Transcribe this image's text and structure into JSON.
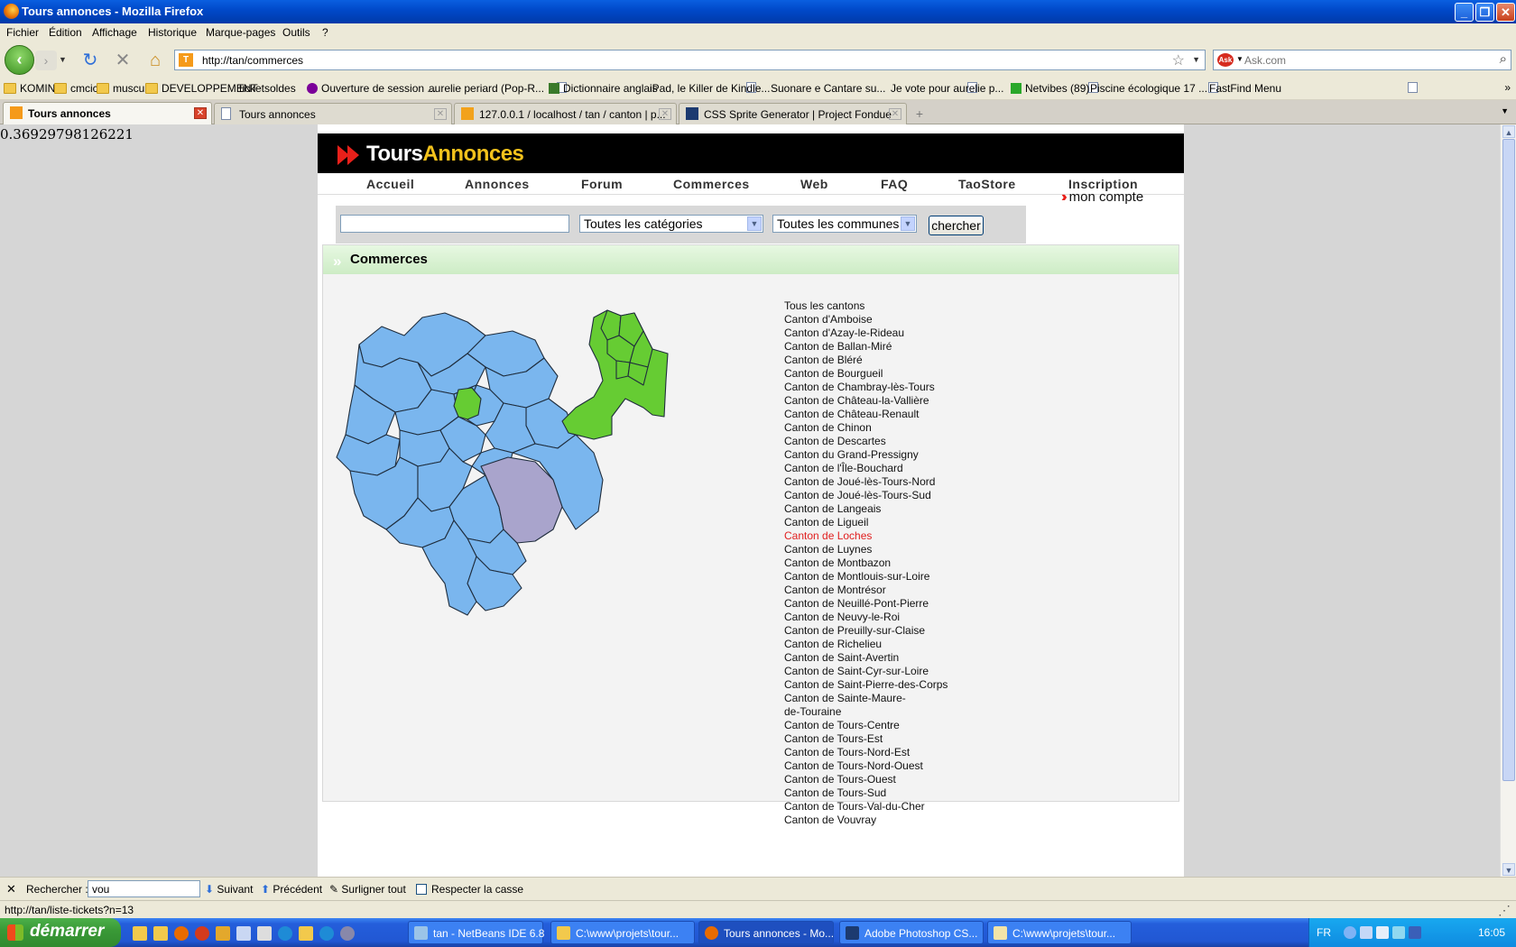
{
  "window": {
    "title": "Tours annonces - Mozilla Firefox",
    "minimize": "_",
    "maximize": "❐",
    "close": "✕"
  },
  "menu": [
    "Fichier",
    "Édition",
    "Affichage",
    "Historique",
    "Marque-pages",
    "Outils",
    "?"
  ],
  "navbar": {
    "url": "http://tan/commerces",
    "search_placeholder": "Ask.com"
  },
  "bookmarks": [
    {
      "label": "KOMIN",
      "icon": "folder"
    },
    {
      "label": "cmcic",
      "icon": "folder"
    },
    {
      "label": "muscu",
      "icon": "folder"
    },
    {
      "label": "DEVELOPPEMENT",
      "icon": "folder"
    },
    {
      "label": "ticketsoldes",
      "icon": "page"
    },
    {
      "label": "Ouverture de session ...",
      "icon": "yahoo"
    },
    {
      "label": "aurelie periard (Pop-R...",
      "icon": "page"
    },
    {
      "label": "Dictionnaire anglais",
      "icon": "wr"
    },
    {
      "label": "iPad, le Killer de Kindle...",
      "icon": "page"
    },
    {
      "label": "Suonare e Cantare su...",
      "icon": "page"
    },
    {
      "label": "Je vote pour aurelie p...",
      "icon": "page"
    },
    {
      "label": "Netvibes (89)",
      "icon": "nv"
    },
    {
      "label": "Piscine écologique 17 ...",
      "icon": "page"
    },
    {
      "label": "FastFind Menu",
      "icon": "page"
    }
  ],
  "bookmarks_more": "»",
  "tabs": [
    {
      "label": "Tours annonces",
      "active": true
    },
    {
      "label": "Tours annonces",
      "active": false
    },
    {
      "label": "127.0.0.1 / localhost / tan / canton | p...",
      "active": false
    },
    {
      "label": "CSS Sprite Generator | Project Fondue",
      "active": false
    }
  ],
  "debug_number": "0.36929798126221",
  "site": {
    "logo_part1": "Tours",
    "logo_part2": "Annonces",
    "nav": [
      "Accueil",
      "Annonces",
      "Forum",
      "Commerces",
      "Web",
      "FAQ",
      "TaoStore",
      "Inscription"
    ],
    "search": {
      "query": "",
      "category": "Toutes les catégories",
      "commune": "Toutes les communes",
      "button": "chercher"
    },
    "account": "mon compte",
    "section_title": "Commerces",
    "cantons": [
      "Tous les cantons",
      "Canton d'Amboise",
      "Canton d'Azay-le-Rideau",
      "Canton de Ballan-Miré",
      "Canton de Bléré",
      "Canton de Bourgueil",
      "Canton de Chambray-lès-Tours",
      "Canton de Château-la-Vallière",
      "Canton de Château-Renault",
      "Canton de Chinon",
      "Canton de Descartes",
      "Canton du Grand-Pressigny",
      "Canton de l'Île-Bouchard",
      "Canton de Joué-lès-Tours-Nord",
      "Canton de Joué-lès-Tours-Sud",
      "Canton de Langeais",
      "Canton de Ligueil",
      "Canton de Loches",
      "Canton de Luynes",
      "Canton de Montbazon",
      "Canton de Montlouis-sur-Loire",
      "Canton de Montrésor",
      "Canton de Neuillé-Pont-Pierre",
      "Canton de Neuvy-le-Roi",
      "Canton de Preuilly-sur-Claise",
      "Canton de Richelieu",
      "Canton de Saint-Avertin",
      "Canton de Saint-Cyr-sur-Loire",
      "Canton de Saint-Pierre-des-Corps",
      "Canton de Sainte-Maure-",
      "de-Touraine",
      "Canton de Tours-Centre",
      "Canton de Tours-Est",
      "Canton de Tours-Nord-Est",
      "Canton de Tours-Nord-Ouest",
      "Canton de Tours-Ouest",
      "Canton de Tours-Sud",
      "Canton de Tours-Val-du-Cher",
      "Canton de Vouvray"
    ],
    "active_canton": "Canton de Loches",
    "colors": {
      "map_default": "#7ab6ee",
      "map_highlight_green": "#66cc33",
      "map_selected": "#a9a4cc",
      "active_link": "#e02020"
    }
  },
  "findbar": {
    "label": "Rechercher :",
    "value": "vou",
    "next": "Suivant",
    "prev": "Précédent",
    "highlight": "Surligner tout",
    "matchcase": "Respecter la casse"
  },
  "status": "http://tan/liste-tickets?n=13",
  "taskbar": {
    "start": "démarrer",
    "tasks": [
      {
        "label": "tan - NetBeans IDE 6.8",
        "active": false
      },
      {
        "label": "C:\\www\\projets\\tour...",
        "active": false
      },
      {
        "label": "Tours annonces - Mo...",
        "active": true
      },
      {
        "label": "Adobe Photoshop CS...",
        "active": false
      },
      {
        "label": "C:\\www\\projets\\tour...",
        "active": false
      }
    ],
    "lang": "FR",
    "clock": "16:05"
  }
}
